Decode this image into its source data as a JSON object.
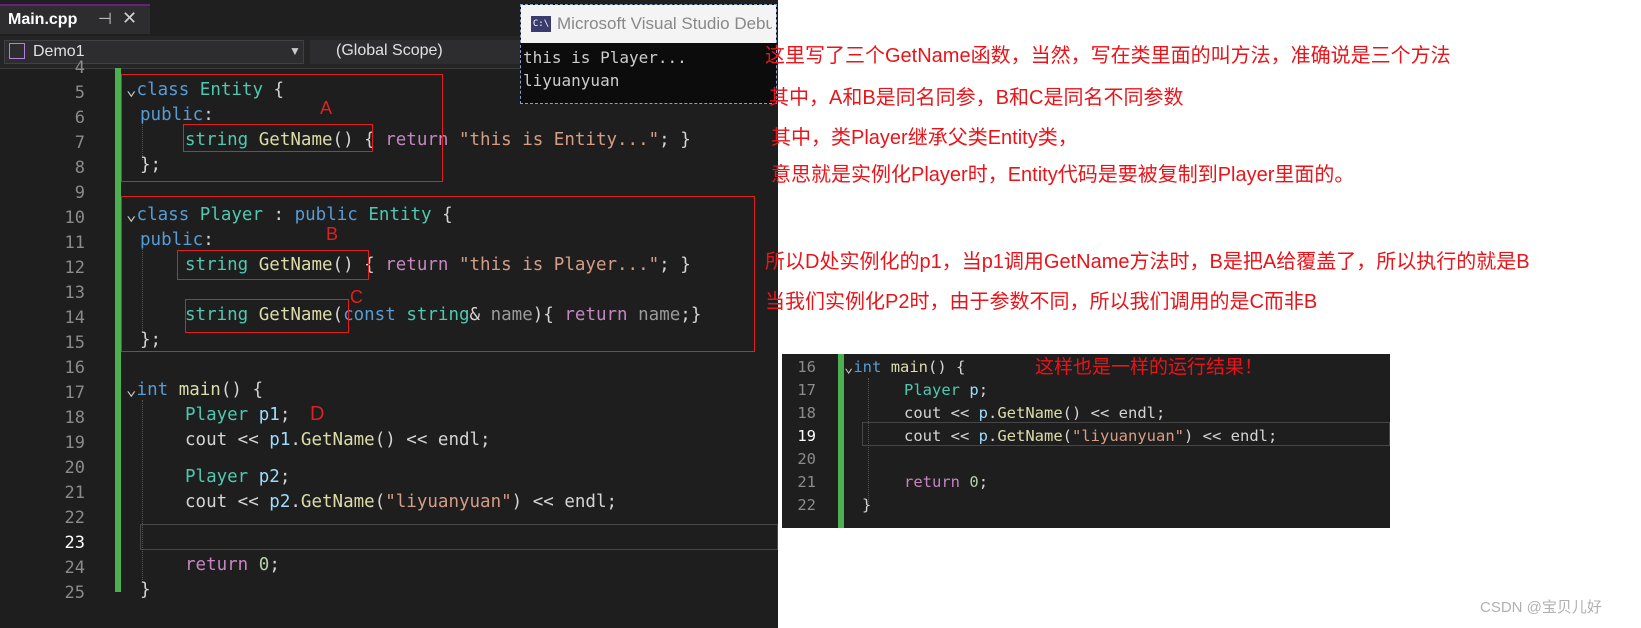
{
  "tab": {
    "filename": "Main.cpp",
    "pin": "⊣",
    "close": "✕"
  },
  "nav": {
    "project": "Demo1",
    "scope": "(Global Scope)"
  },
  "console": {
    "title": "Microsoft Visual Studio Debug Console",
    "lines": [
      "this is Player...",
      "liyuanyuan"
    ]
  },
  "editor_lines": [
    {
      "n": "4",
      "code": ""
    },
    {
      "n": "5",
      "code": "class Entity {"
    },
    {
      "n": "6",
      "code": " public:"
    },
    {
      "n": "7",
      "code": "string GetName() { return \"this is Entity...\"; }"
    },
    {
      "n": "8",
      "code": "};"
    },
    {
      "n": "9",
      "code": ""
    },
    {
      "n": "10",
      "code": "class Player : public Entity {"
    },
    {
      "n": "11",
      "code": " public:"
    },
    {
      "n": "12",
      "code": "string GetName() { return \"this is Player...\"; }"
    },
    {
      "n": "13",
      "code": ""
    },
    {
      "n": "14",
      "code": "string GetName(const string& name){ return name;}"
    },
    {
      "n": "15",
      "code": "};"
    },
    {
      "n": "16",
      "code": ""
    },
    {
      "n": "17",
      "code": "int main() {"
    },
    {
      "n": "18",
      "code": "Player p1;"
    },
    {
      "n": "19",
      "code": "cout << p1.GetName() << endl;"
    },
    {
      "n": "20",
      "code": "Player p2;"
    },
    {
      "n": "21",
      "code": "cout << p2.GetName(\"liyuanyuan\") << endl;"
    },
    {
      "n": "22",
      "code": ""
    },
    {
      "n": "23",
      "code": ""
    },
    {
      "n": "24",
      "code": "return 0;"
    },
    {
      "n": "25",
      "code": "}"
    }
  ],
  "markers": {
    "a": "A",
    "b": "B",
    "c": "C",
    "d": "D"
  },
  "notes": [
    "这里写了三个GetName函数，当然，写在类里面的叫方法，准确说是三个方法",
    "其中，A和B是同名同参，B和C是同名不同参数",
    "其中，类Player继承父类Entity类，",
    "意思就是实例化Player时，Entity代码是要被复制到Player里面的。",
    "所以D处实例化的p1，当p1调用GetName方法时，B是把A给覆盖了，所以执行的就是B",
    "当我们实例化P2时，由于参数不同，所以我们调用的是C而非B"
  ],
  "editor2_lines": [
    {
      "n": "16",
      "code": "int main() {"
    },
    {
      "n": "17",
      "code": "Player p;"
    },
    {
      "n": "18",
      "code": "cout << p.GetName() << endl;"
    },
    {
      "n": "19",
      "code": "cout << p.GetName(\"liyuanyuan\") << endl;"
    },
    {
      "n": "20",
      "code": ""
    },
    {
      "n": "21",
      "code": "return 0;"
    },
    {
      "n": "22",
      "code": "}"
    }
  ],
  "editor2_note": "这样也是一样的运行结果！",
  "watermark": "CSDN @宝贝儿好",
  "colors": {
    "accent_red": "#e8141a",
    "change_bar": "#4caf50",
    "keyword": "#569cd6",
    "type": "#4ec9b0",
    "function": "#dcdcaa"
  }
}
